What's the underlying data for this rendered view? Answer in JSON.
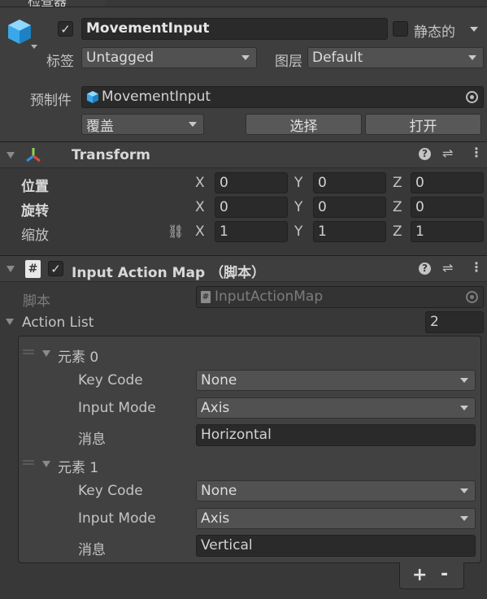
{
  "window": {
    "tab_title": "检查器"
  },
  "gameobject": {
    "name": "MovementInput",
    "static_label": "静态的",
    "tag_label": "标签",
    "tag_value": "Untagged",
    "layer_label": "图层",
    "layer_value": "Default",
    "prefab_label": "预制件",
    "prefab_value": "MovementInput",
    "overrides_value": "覆盖",
    "select_label": "选择",
    "open_label": "打开"
  },
  "transform": {
    "title": "Transform",
    "position_label": "位置",
    "rotation_label": "旋转",
    "scale_label": "缩放",
    "x": "X",
    "y": "Y",
    "z": "Z",
    "position": [
      "0",
      "0",
      "0"
    ],
    "rotation": [
      "0",
      "0",
      "0"
    ],
    "scale": [
      "1",
      "1",
      "1"
    ]
  },
  "component": {
    "title": "Input Action Map （脚本）",
    "script_label": "脚本",
    "script_value": "InputActionMap",
    "list_label": "Action List",
    "list_count": "2",
    "elements": [
      {
        "title": "元素 0",
        "keycode_label": "Key Code",
        "keycode_value": "None",
        "inputmode_label": "Input Mode",
        "inputmode_value": "Axis",
        "message_label": "消息",
        "message_value": "Horizontal"
      },
      {
        "title": "元素 1",
        "keycode_label": "Key Code",
        "keycode_value": "None",
        "inputmode_label": "Input Mode",
        "inputmode_value": "Axis",
        "message_label": "消息",
        "message_value": "Vertical"
      }
    ],
    "add_label": "+",
    "remove_label": "-"
  }
}
